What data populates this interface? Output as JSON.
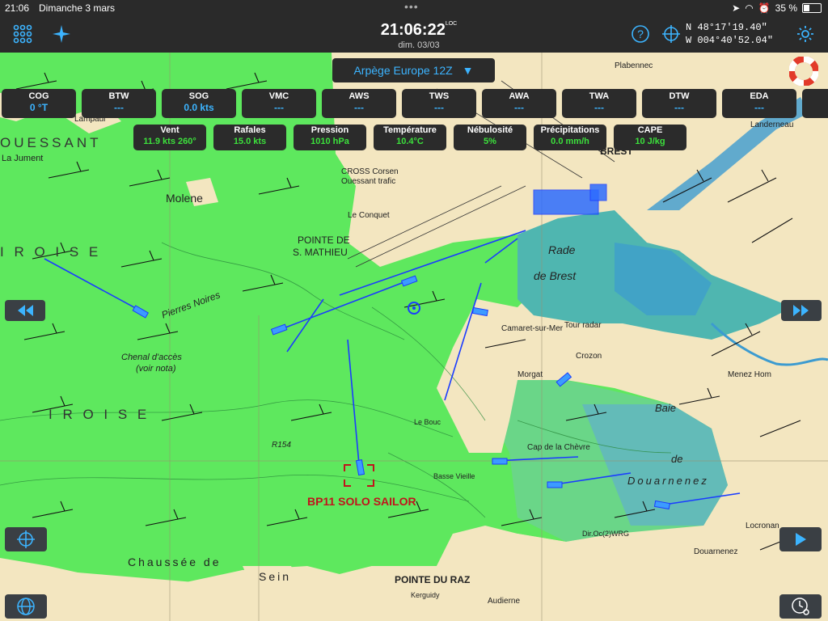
{
  "status": {
    "time": "21:06",
    "date": "Dimanche 3 mars",
    "battery": "35 %"
  },
  "topbar": {
    "clock_time": "21:06:22",
    "clock_loc": "LOC",
    "clock_date": "dim. 03/03",
    "lat": "N  48°17'19.40\"",
    "lon": "W 004°40'52.04\"",
    "icons": [
      "grid-menu-icon",
      "compass-star-icon",
      "help-icon",
      "crosshair-icon",
      "settings-gear-icon"
    ]
  },
  "model_selector": {
    "label": "Arpège Europe 12Z",
    "arrow": "▼"
  },
  "instruments": [
    {
      "label": "COG",
      "value": "0 °T"
    },
    {
      "label": "BTW",
      "value": "---"
    },
    {
      "label": "SOG",
      "value": "0.0 kts"
    },
    {
      "label": "VMC",
      "value": "---"
    },
    {
      "label": "AWS",
      "value": "---"
    },
    {
      "label": "TWS",
      "value": "---"
    },
    {
      "label": "AWA",
      "value": "---"
    },
    {
      "label": "TWA",
      "value": "---"
    },
    {
      "label": "DTW",
      "value": "---"
    },
    {
      "label": "EDA",
      "value": "---"
    }
  ],
  "weather": [
    {
      "label": "Vent",
      "value": "11.9 kts 260°"
    },
    {
      "label": "Rafales",
      "value": "15.0 kts"
    },
    {
      "label": "Pression",
      "value": "1010 hPa"
    },
    {
      "label": "Température",
      "value": "10.4°C"
    },
    {
      "label": "Nébulosité",
      "value": "5%"
    },
    {
      "label": "Précipitations",
      "value": "0.0 mm/h"
    },
    {
      "label": "CAPE",
      "value": "10 J/kg"
    }
  ],
  "map": {
    "places": {
      "ouessant": "OUESSANT",
      "iroise1": "I R O I S E",
      "iroise2": "I R O I S E",
      "molene": "Molene",
      "pointe_st_mathieu": "POINTE DE",
      "st_mathieu": "S. MATHIEU",
      "brest": "BREST",
      "rade": "Rade",
      "de_brest": "de Brest",
      "tour_radar": "Tour radar",
      "camaret": "Camaret-sur-Mer",
      "crozon": "Crozon",
      "morgat": "Morgat",
      "cap_chevre": "Cap de la Chèvre",
      "baie": "Baie",
      "de": "de",
      "douarnenez_bay": "Douarnenez",
      "douarnenez": "Douarnenez",
      "pointe_du_raz": "POINTE DU RAZ",
      "audierne": "Audierne",
      "plabennec": "Plabennec",
      "landerneau": "Landerneau",
      "chenal": "Chenal d'accès",
      "voir_nota": "(voir nota)",
      "pierres_noires": "Pierres Noires",
      "chaussee_sein": "Chaussée de",
      "sein": "Sein",
      "cross": "CROSS Corsen",
      "ouessant_traffic": "Ouessant trafic",
      "le_conquet": "Le Conquet",
      "la_jument": "La Jument",
      "lampaul": "Lampaul",
      "menez_hom": "Menez Hom",
      "locronan": "Locronan",
      "kerguidy": "Kerguidy",
      "r154": "R154",
      "basse_vieille": "Basse Vieille",
      "le_bouc": "Le Bouc",
      "dir_oc": "Dir.Oc(2)WRG"
    },
    "boat_label": "BP11 SOLO SAILOR"
  },
  "colors": {
    "accent": "#3cb4ff",
    "weather_value": "#3ce03c",
    "sea_green": "#58e85a",
    "land": "#f3e6c0",
    "track": "#1a3cff",
    "boat_label": "#c0141c"
  }
}
